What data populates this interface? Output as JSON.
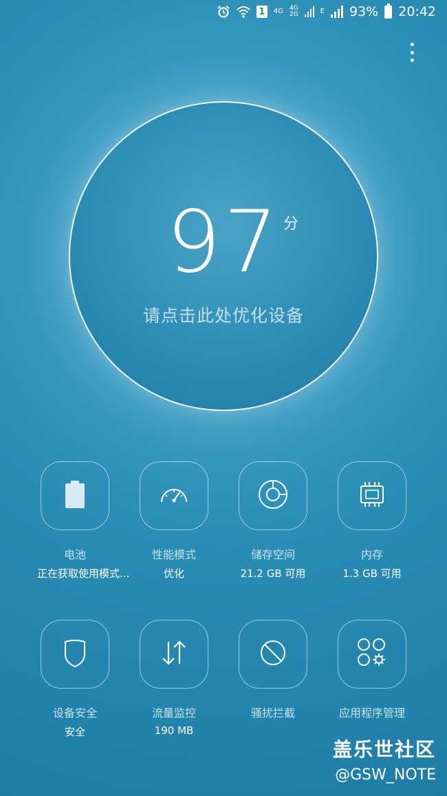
{
  "status_bar": {
    "net_4g": "4G",
    "net_4g2g_top": "4G",
    "net_4g2g_bottom": "2G",
    "net_e": "E",
    "sim": "1",
    "battery_percent": "93%",
    "time": "20:42",
    "icons": [
      "alarm-icon",
      "wifi-icon",
      "sim-icon",
      "signal-icon",
      "battery-icon"
    ]
  },
  "score": {
    "value": "97",
    "unit": "分",
    "hint": "请点击此处优化设备"
  },
  "tiles": [
    {
      "label": "电池",
      "sub": "正在获取使用模式...",
      "icon": "battery-icon"
    },
    {
      "label": "性能模式",
      "sub": "优化",
      "icon": "speedometer-icon"
    },
    {
      "label": "储存空间",
      "sub": "21.2 GB 可用",
      "icon": "storage-icon"
    },
    {
      "label": "内存",
      "sub": "1.3 GB 可用",
      "icon": "memory-chip-icon"
    },
    {
      "label": "设备安全",
      "sub": "安全",
      "icon": "shield-icon"
    },
    {
      "label": "流量监控",
      "sub": "190 MB",
      "icon": "data-transfer-icon"
    },
    {
      "label": "骚扰拦截",
      "sub": "",
      "icon": "block-icon"
    },
    {
      "label": "应用程序管理",
      "sub": "",
      "icon": "app-manager-icon"
    }
  ],
  "watermark": {
    "line1": "盖乐世社区",
    "line2": "@GSW_NOTE"
  },
  "colors": {
    "background": "#2a8db6",
    "circle": "#2c8db5",
    "accent": "#ffffff"
  }
}
